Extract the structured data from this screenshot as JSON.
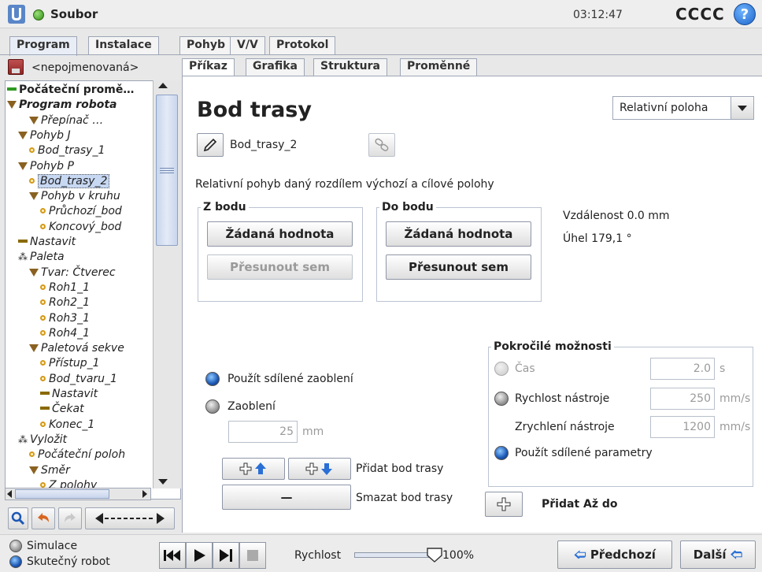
{
  "topbar": {
    "app_name": "Soubor",
    "time": "03:12:47",
    "robot_name": "CCCC",
    "help_symbol": "?"
  },
  "main_tabs": [
    "Program",
    "Instalace",
    "Pohyb",
    "V/V",
    "Protokol"
  ],
  "left": {
    "program_name": "<nepojmenovaná>",
    "tree": [
      {
        "label": "Počáteční promě…",
        "type": "bar-green",
        "style": "bold"
      },
      {
        "label": "Program robota",
        "type": "triangle",
        "style": "bolditalic"
      },
      {
        "label": "Přepínač …",
        "type": "triangle",
        "style": "italic"
      },
      {
        "label": "Pohyb J",
        "type": "triangle",
        "style": "italic"
      },
      {
        "label": "Bod_trasy_1",
        "type": "dot",
        "style": "italic"
      },
      {
        "label": "Pohyb P",
        "type": "triangle",
        "style": "italic"
      },
      {
        "label": "Bod_trasy_2",
        "type": "dot",
        "style": "italic",
        "selected": true
      },
      {
        "label": "Pohyb v kruhu",
        "type": "triangle",
        "style": "italic"
      },
      {
        "label": "Průchozí_bod",
        "type": "dot",
        "style": "italic"
      },
      {
        "label": "Koncový_bod",
        "type": "dot",
        "style": "italic"
      },
      {
        "label": "Nastavit",
        "type": "bar",
        "style": "italic"
      },
      {
        "label": "Paleta",
        "type": "pallet",
        "style": "italic"
      },
      {
        "label": "Tvar: Čtverec",
        "type": "triangle",
        "style": "italic"
      },
      {
        "label": "Roh1_1",
        "type": "dot",
        "style": "italic"
      },
      {
        "label": "Roh2_1",
        "type": "dot",
        "style": "italic"
      },
      {
        "label": "Roh3_1",
        "type": "dot",
        "style": "italic"
      },
      {
        "label": "Roh4_1",
        "type": "dot",
        "style": "italic"
      },
      {
        "label": "Paletová sekve",
        "type": "triangle",
        "style": "italic"
      },
      {
        "label": "Přístup_1",
        "type": "dot",
        "style": "italic"
      },
      {
        "label": "Bod_tvaru_1",
        "type": "dot",
        "style": "italic"
      },
      {
        "label": "Nastavit",
        "type": "bar",
        "style": "italic"
      },
      {
        "label": "Čekat",
        "type": "bar",
        "style": "italic"
      },
      {
        "label": "Konec_1",
        "type": "dot",
        "style": "italic"
      },
      {
        "label": "Vyložit",
        "type": "pallet",
        "style": "italic"
      },
      {
        "label": "Počáteční poloh",
        "type": "dot",
        "style": "italic"
      },
      {
        "label": "Směr",
        "type": "triangle",
        "style": "italic"
      },
      {
        "label": "Z polohy",
        "type": "dot",
        "style": "italic"
      }
    ]
  },
  "sub_tabs": [
    "Příkaz",
    "Grafika",
    "Struktura",
    "Proměnné"
  ],
  "main": {
    "title": "Bod trasy",
    "mode_select": "Relativní poloha",
    "waypoint_name": "Bod_trasy_2",
    "description": "Relativní pohyb daný rozdílem výchozí a cílové polohy",
    "from": {
      "title": "Z bodu",
      "set_label": "Žádaná hodnota",
      "move_label": "Přesunout sem"
    },
    "to": {
      "title": "Do bodu",
      "set_label": "Žádaná hodnota",
      "move_label": "Přesunout sem"
    },
    "distance": "Vzdálenost 0.0 mm",
    "angle": "Úhel 179,1 °",
    "blend_shared": "Použít sdílené zaoblení",
    "blend": "Zaoblení",
    "blend_value": "25",
    "blend_unit": "mm",
    "add_waypoint": "Přidat bod trasy",
    "delete_waypoint": "Smazat bod trasy",
    "minus_symbol": "—",
    "plus_symbol": "+",
    "advanced": {
      "title": "Pokročilé možnosti",
      "time_label": "Čas",
      "time_value": "2.0",
      "time_unit": "s",
      "speed_label": "Rychlost nástroje",
      "speed_value": "250",
      "speed_unit": "mm/s",
      "accel_label": "Zrychlení nástroje",
      "accel_value": "1200",
      "accel_unit": "mm/s",
      "shared_label": "Použít sdílené parametry"
    },
    "add_until": "Přidat Až do"
  },
  "footer": {
    "simulation": "Simulace",
    "real_robot": "Skutečný robot",
    "speed_label": "Rychlost",
    "speed_value": "100%",
    "speed_fraction": 1.0,
    "prev": "Předchozí",
    "next": "Další"
  },
  "colors": {
    "accent_blue": "#1b57b5",
    "status_green": "#2f8d14",
    "nav_arrow_blue": "#2a6fd6"
  }
}
